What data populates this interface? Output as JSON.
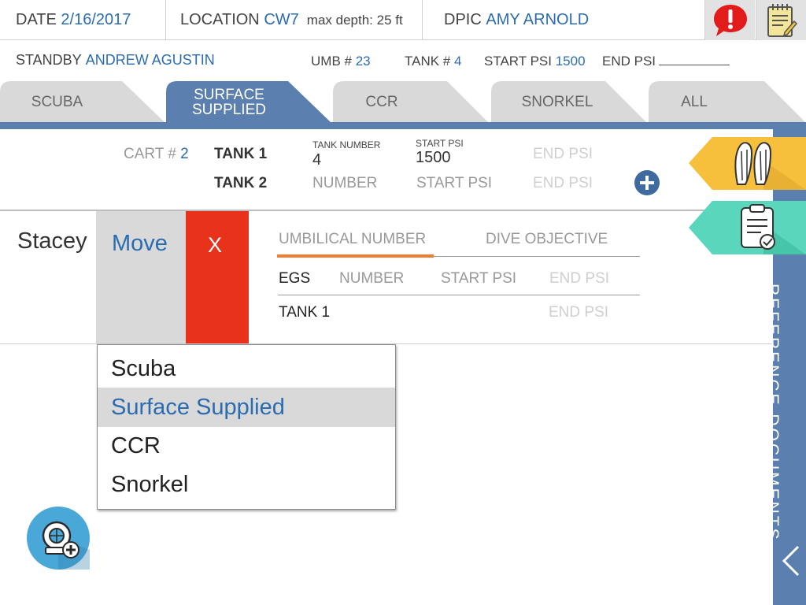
{
  "header": {
    "date_label": "DATE",
    "date_value": "2/16/2017",
    "location_label": "LOCATION",
    "location_value": "CW7",
    "max_depth": "max depth: 25 ft",
    "dpic_label": "DPIC",
    "dpic_value": "AMY ARNOLD",
    "alert_icon": "alert-icon",
    "notes_icon": "notepad-icon"
  },
  "subheader": {
    "standby_label": "STANDBY",
    "standby_value": "ANDREW AGUSTIN",
    "umb_label": "UMB #",
    "umb_value": "23",
    "tank_label": "TANK #",
    "tank_value": "4",
    "start_psi_label": "START PSI",
    "start_psi_value": "1500",
    "end_psi_label": "END PSI"
  },
  "tabs": [
    {
      "label": "SCUBA",
      "active": false
    },
    {
      "label": "SURFACE SUPPLIED",
      "line1": "SURFACE",
      "line2": "SUPPLIED",
      "active": true
    },
    {
      "label": "CCR",
      "active": false
    },
    {
      "label": "SNORKEL",
      "active": false
    },
    {
      "label": "ALL",
      "active": false
    }
  ],
  "cart": {
    "cart_label": "CART #",
    "cart_value": "2",
    "tank1_label": "TANK 1",
    "tank_number_caption": "TANK NUMBER",
    "tank1_number": "4",
    "start_psi_caption": "START PSI",
    "tank1_start_psi": "1500",
    "tank1_end_psi_placeholder": "END PSI",
    "tank2_label": "TANK 2",
    "tank2_number_placeholder": "NUMBER",
    "tank2_start_psi_placeholder": "START PSI",
    "tank2_end_psi_placeholder": "END PSI"
  },
  "diver": {
    "name": "Stacey",
    "move_label": "Move",
    "remove_label": "X",
    "umbilical_placeholder": "UMBILICAL NUMBER",
    "dive_objective_placeholder": "DIVE OBJECTIVE",
    "egs_label": "EGS",
    "egs_number_placeholder": "NUMBER",
    "egs_start_psi_placeholder": "START PSI",
    "egs_end_psi_placeholder": "END PSI",
    "tank1_label": "TANK 1",
    "tank1_end_psi_placeholder": "END PSI"
  },
  "dropdown": {
    "options": [
      "Scuba",
      "Surface Supplied",
      "CCR",
      "Snorkel"
    ],
    "selected": "Surface Supplied"
  },
  "sidebar": {
    "label": "REFERENCE DOCUMENTS",
    "fins_icon": "fins-icon",
    "clipboard_icon": "clipboard-check-icon"
  },
  "colors": {
    "accent_blue": "#2b6cb0",
    "tab_active": "#5b7fae",
    "remove_red": "#e8321c",
    "fins_tab": "#f6bf3c",
    "clipboard_tab": "#59d6bb",
    "add_diver_fab": "#4aa8d8"
  }
}
